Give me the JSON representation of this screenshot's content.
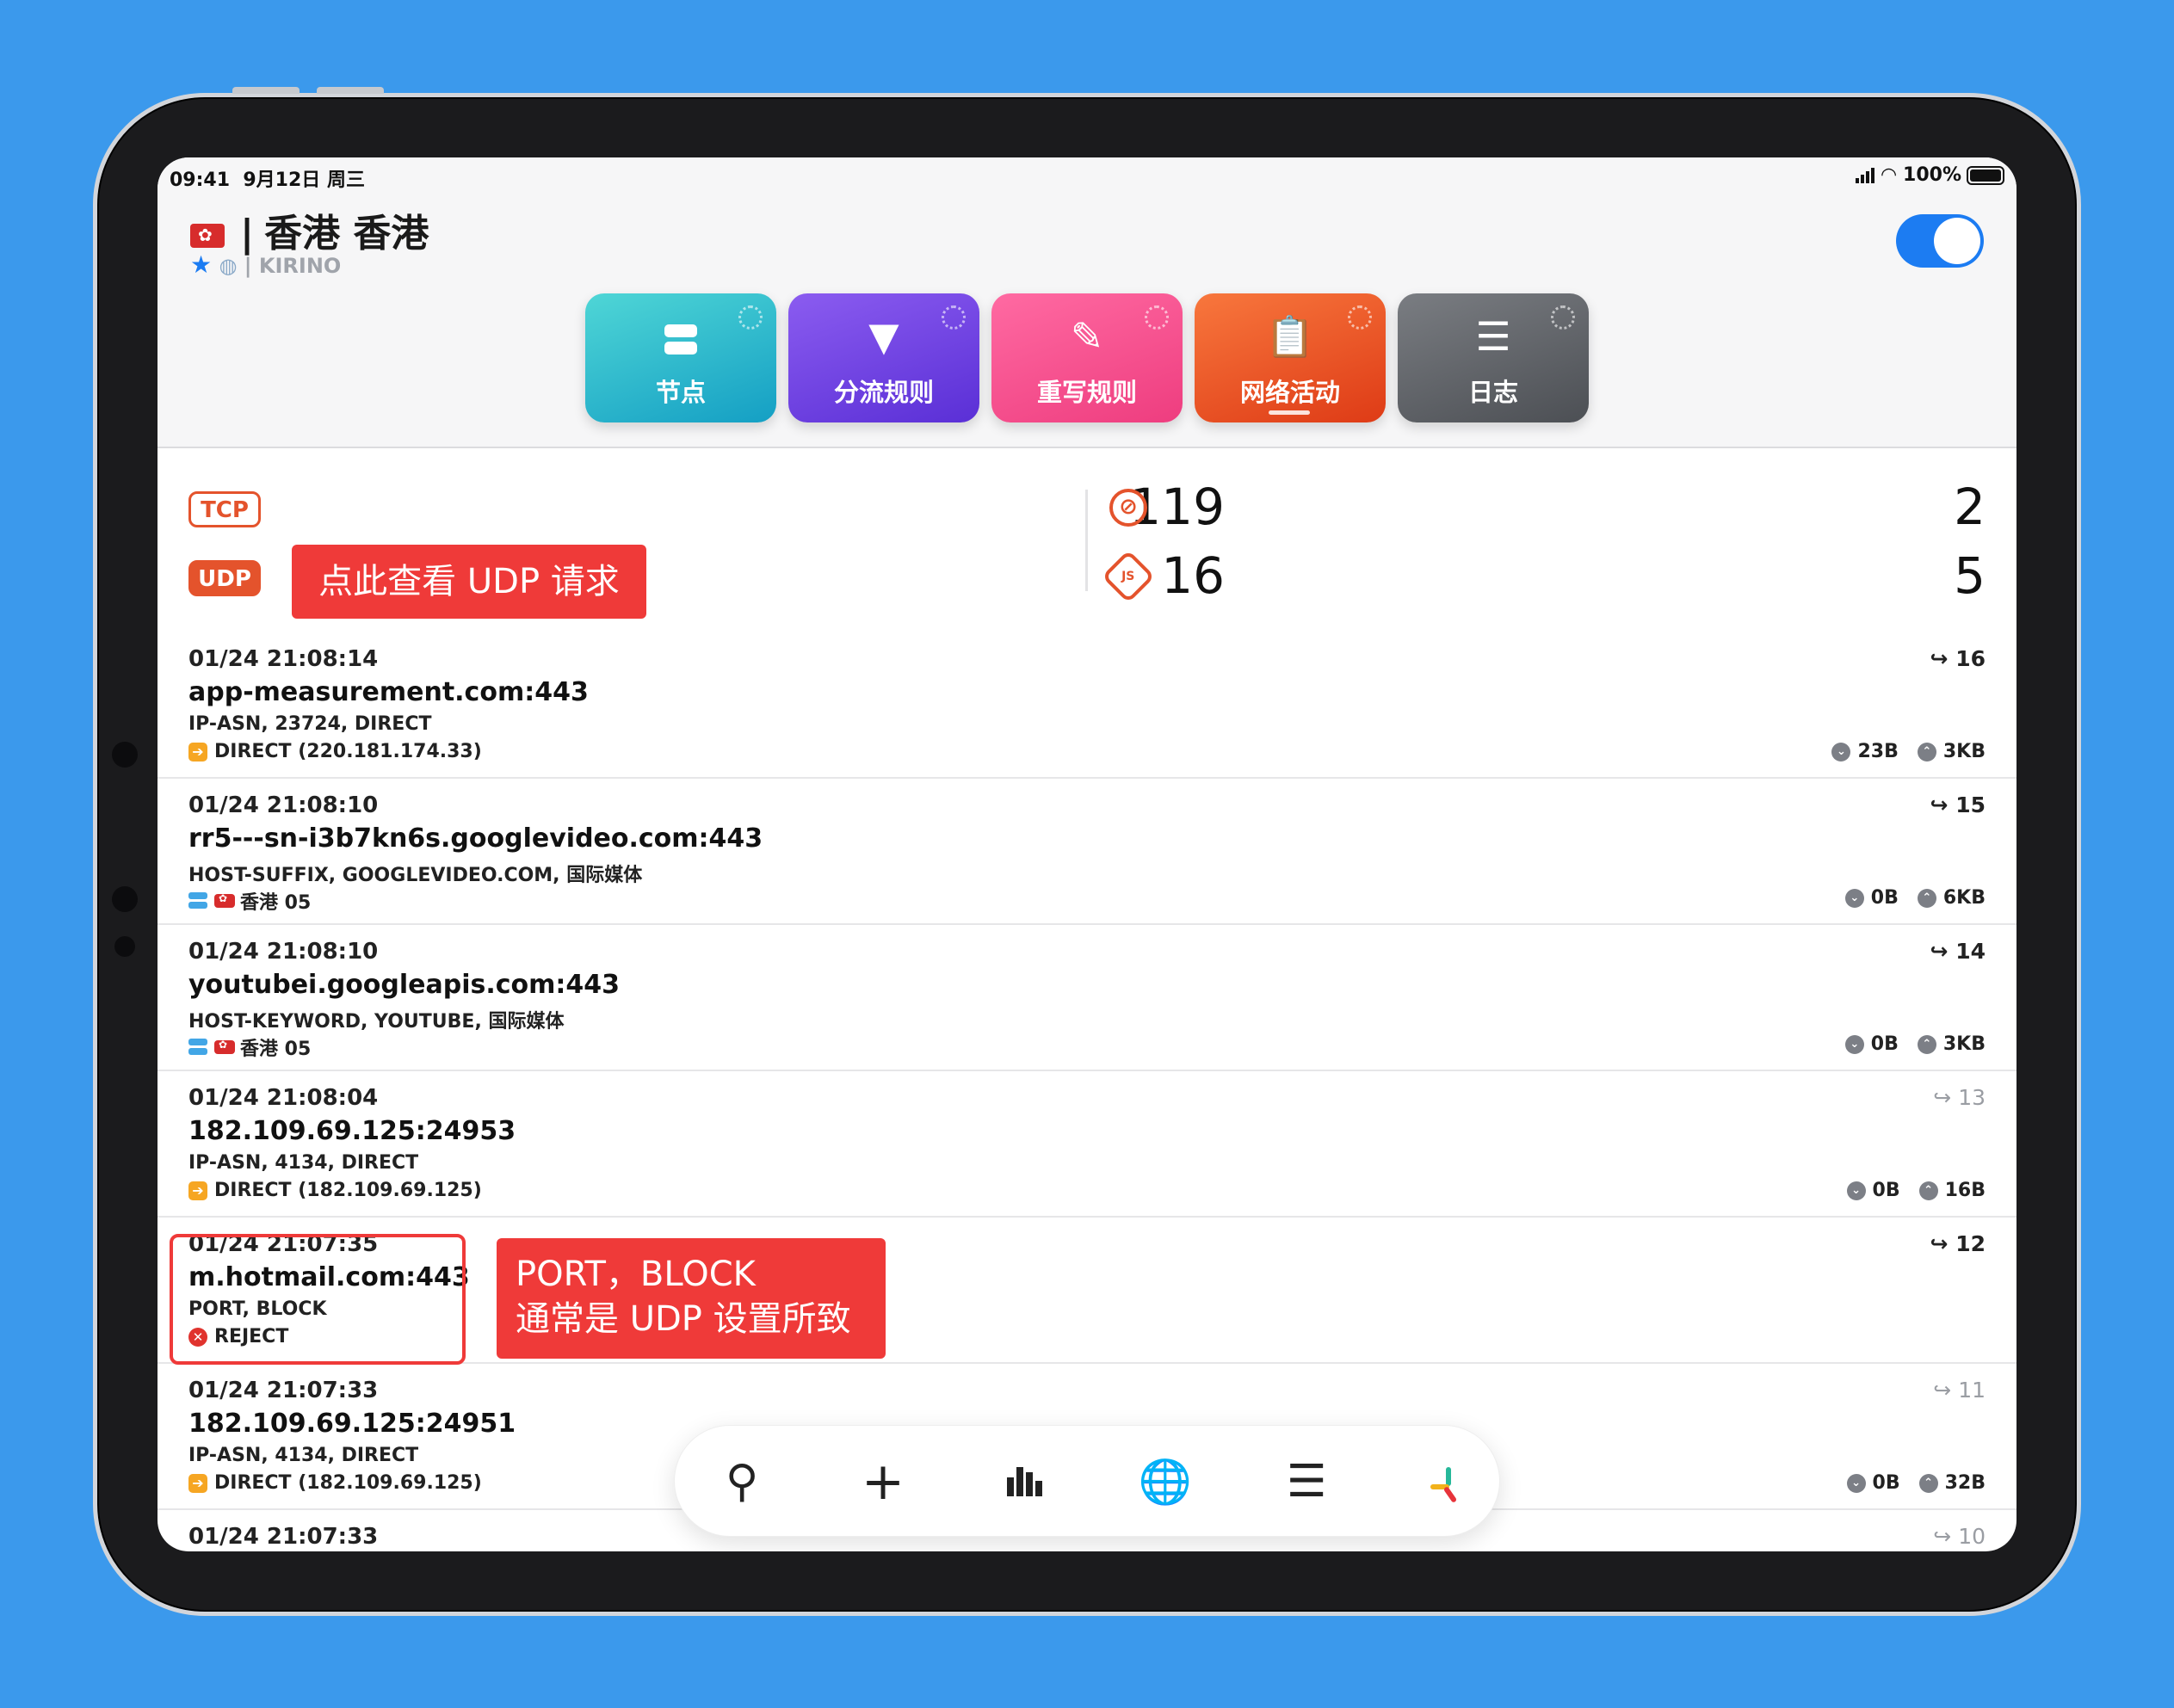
{
  "status_bar": {
    "time": "09:41",
    "date": "9月12日 周三",
    "battery": "100%"
  },
  "header": {
    "title": "香港 香港",
    "subtitle": "| KIRINO"
  },
  "tiles": [
    {
      "label": "节点",
      "color": "#1fb8cc"
    },
    {
      "label": "分流规则",
      "color": "#6e3fe0"
    },
    {
      "label": "重写规则",
      "color": "#f34a8c"
    },
    {
      "label": "网络活动",
      "color": "#ea5427"
    },
    {
      "label": "日志",
      "color": "#5d6066"
    }
  ],
  "stats": {
    "tcp_label": "TCP",
    "tcp_count": "119",
    "udp_label": "UDP",
    "udp_count": "16",
    "blocked_count": "2",
    "js_count": "5",
    "js_label": "JS"
  },
  "annotations": {
    "udp_hint": "点此查看 UDP 请求",
    "block_hint_1": "PORT，BLOCK",
    "block_hint_2": "通常是 UDP 设置所致"
  },
  "requests": [
    {
      "time": "01/24 21:08:14",
      "host": "app-measurement.com:443",
      "rule": "IP-ASN, 23724, DIRECT",
      "policy": "DIRECT (220.181.174.33)",
      "policy_type": "direct",
      "count": "16",
      "down": "23B",
      "up": "3KB"
    },
    {
      "time": "01/24 21:08:10",
      "host": "rr5---sn-i3b7kn6s.googlevideo.com:443",
      "rule": "HOST-SUFFIX, GOOGLEVIDEO.COM, 国际媒体",
      "policy": "香港 05",
      "policy_type": "proxy",
      "count": "15",
      "down": "0B",
      "up": "6KB"
    },
    {
      "time": "01/24 21:08:10",
      "host": "youtubei.googleapis.com:443",
      "rule": "HOST-KEYWORD, YOUTUBE, 国际媒体",
      "policy": "香港 05",
      "policy_type": "proxy",
      "count": "14",
      "down": "0B",
      "up": "3KB"
    },
    {
      "time": "01/24 21:08:04",
      "host": "182.109.69.125:24953",
      "rule": "IP-ASN, 4134, DIRECT",
      "policy": "DIRECT (182.109.69.125)",
      "policy_type": "direct",
      "count": "13",
      "down": "0B",
      "up": "16B"
    },
    {
      "time": "01/24 21:07:35",
      "host": "m.hotmail.com:443",
      "rule": "PORT, BLOCK",
      "policy": "REJECT",
      "policy_type": "reject",
      "count": "12",
      "down": "",
      "up": ""
    },
    {
      "time": "01/24 21:07:33",
      "host": "182.109.69.125:24951",
      "rule": "IP-ASN, 4134, DIRECT",
      "policy": "DIRECT (182.109.69.125)",
      "policy_type": "direct",
      "count": "11",
      "down": "0B",
      "up": "32B"
    },
    {
      "time": "01/24 21:07:33",
      "host": "",
      "rule": "",
      "policy": "",
      "policy_type": "",
      "count": "10",
      "down": "",
      "up": ""
    }
  ],
  "toolbar": {
    "icons": [
      "search-icon",
      "add-icon",
      "chart-icon",
      "globe-icon",
      "list-icon",
      "logo-icon"
    ]
  }
}
